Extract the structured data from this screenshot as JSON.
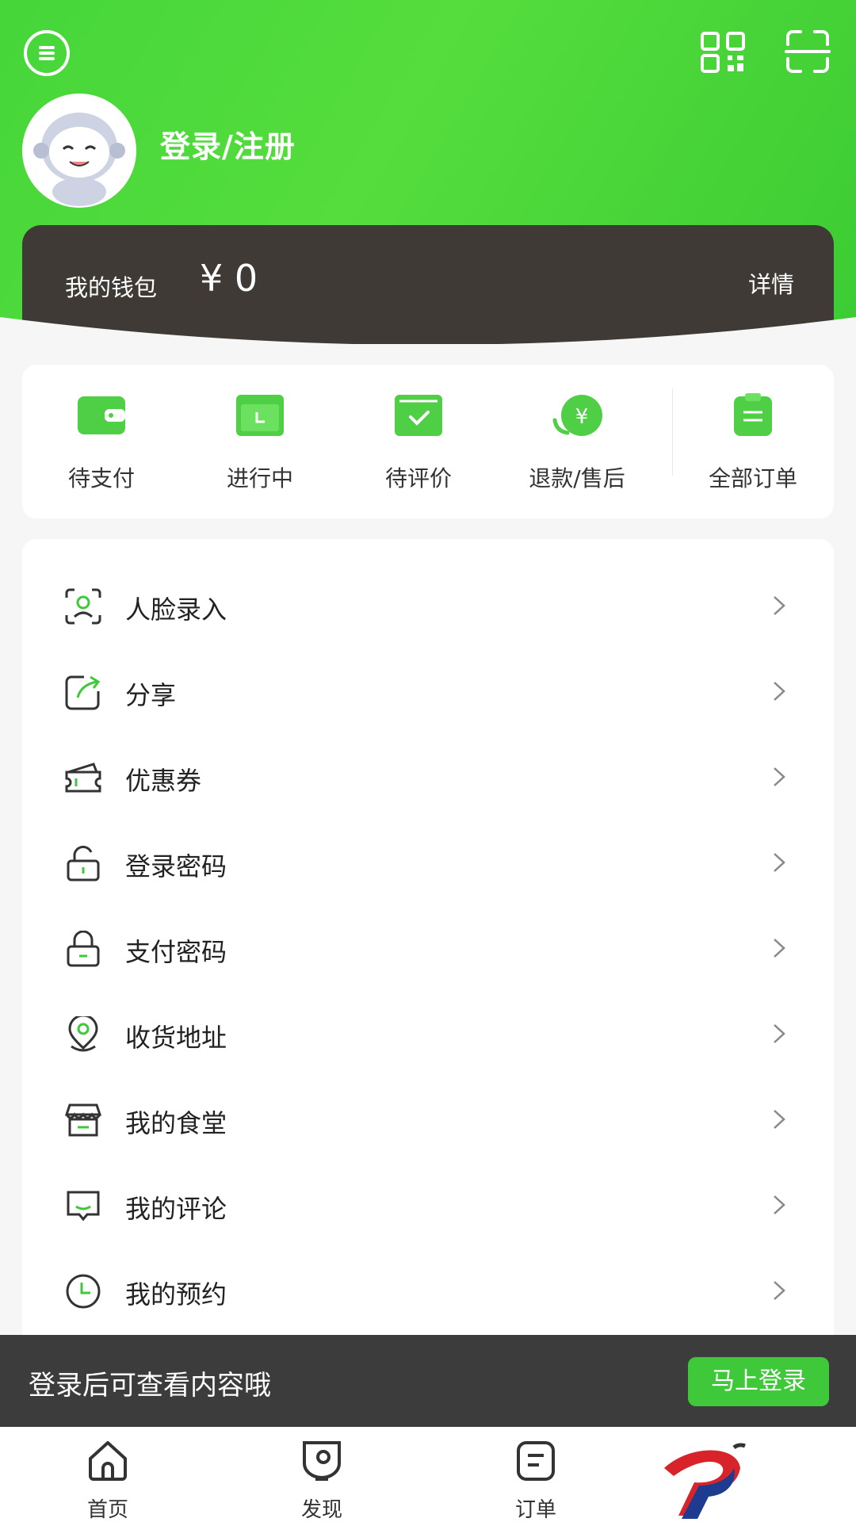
{
  "header": {
    "login_label": "登录/注册"
  },
  "wallet": {
    "label": "我的钱包",
    "amount": "¥ 0",
    "detail_label": "详情"
  },
  "orders": [
    {
      "label": "待支付",
      "icon": "wallet-icon"
    },
    {
      "label": "进行中",
      "icon": "calendar-icon"
    },
    {
      "label": "待评价",
      "icon": "check-box-icon"
    },
    {
      "label": "退款/售后",
      "icon": "refund-yen-icon"
    },
    {
      "label": "全部订单",
      "icon": "clipboard-icon"
    }
  ],
  "menu": [
    {
      "label": "人脸录入",
      "icon": "face-scan-icon"
    },
    {
      "label": "分享",
      "icon": "share-icon"
    },
    {
      "label": "优惠券",
      "icon": "coupon-icon"
    },
    {
      "label": "登录密码",
      "icon": "unlock-icon"
    },
    {
      "label": "支付密码",
      "icon": "lock-icon"
    },
    {
      "label": "收货地址",
      "icon": "location-pin-icon"
    },
    {
      "label": "我的食堂",
      "icon": "canteen-store-icon"
    },
    {
      "label": "我的评论",
      "icon": "comment-icon"
    },
    {
      "label": "我的预约",
      "icon": "clock-icon"
    }
  ],
  "prompt": {
    "text": "登录后可查看内容哦",
    "button_label": "马上登录"
  },
  "tabs": [
    {
      "label": "首页",
      "icon": "home-icon"
    },
    {
      "label": "发现",
      "icon": "discover-icon"
    },
    {
      "label": "订单",
      "icon": "order-icon"
    }
  ],
  "colors": {
    "brand_green": "#46d63a",
    "wallet_bg": "#3f3a36",
    "prompt_bg": "#3c3c3c"
  }
}
